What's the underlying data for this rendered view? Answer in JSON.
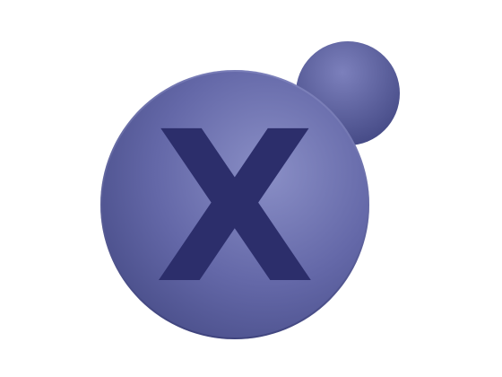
{
  "logo": {
    "letter": "X",
    "colors": {
      "big_circle_light": "#8a8fc6",
      "big_circle_mid": "#6468a8",
      "big_circle_dark": "#464b86",
      "small_circle_light": "#7c80bc",
      "small_circle_dark": "#3f4480",
      "letter_color": "#2c2e6b",
      "letter_highlight": "#3a3d7e",
      "background": "#ffffff"
    }
  }
}
